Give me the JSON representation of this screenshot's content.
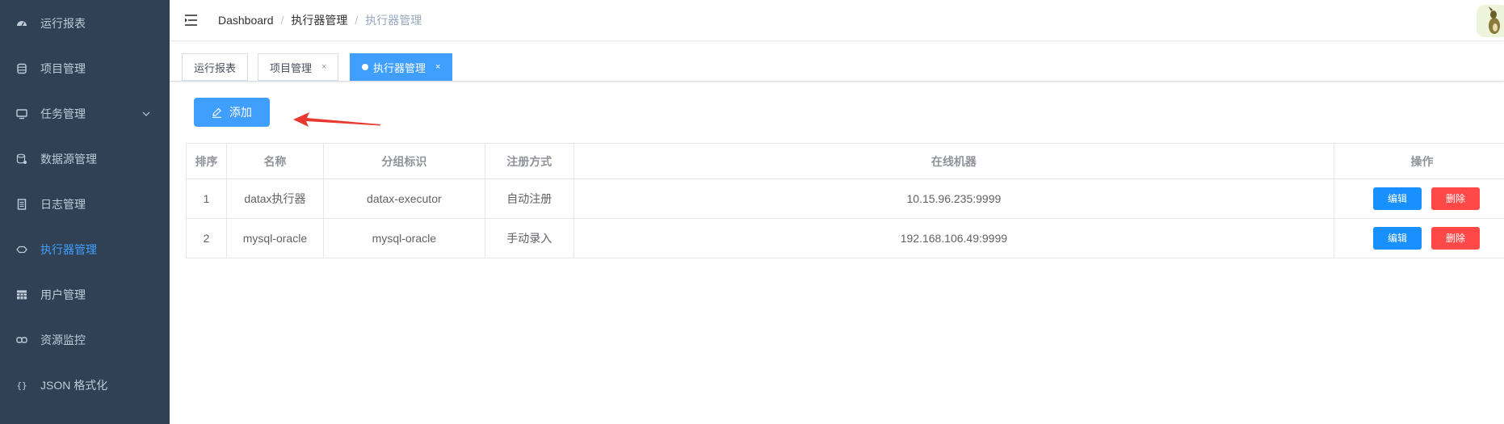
{
  "sidebar": {
    "items": [
      {
        "label": "运行报表",
        "icon": "dashboard-icon"
      },
      {
        "label": "项目管理",
        "icon": "database-icon"
      },
      {
        "label": "任务管理",
        "icon": "monitor-icon"
      },
      {
        "label": "数据源管理",
        "icon": "datasource-icon"
      },
      {
        "label": "日志管理",
        "icon": "document-icon"
      },
      {
        "label": "执行器管理",
        "icon": "executor-icon"
      },
      {
        "label": "用户管理",
        "icon": "table-icon"
      },
      {
        "label": "资源监控",
        "icon": "link-icon"
      },
      {
        "label": "JSON 格式化",
        "icon": "braces-icon"
      }
    ]
  },
  "navbar": {
    "breadcrumb": [
      "Dashboard",
      "执行器管理",
      "执行器管理"
    ]
  },
  "tags": [
    {
      "label": "运行报表"
    },
    {
      "label": "项目管理",
      "close": "×"
    },
    {
      "label": "执行器管理",
      "close": "×"
    }
  ],
  "toolbar": {
    "add_label": "添加"
  },
  "table": {
    "headers": [
      "排序",
      "名称",
      "分组标识",
      "注册方式",
      "在线机器",
      "操作"
    ],
    "rows": [
      {
        "order": "1",
        "name": "datax执行器",
        "group": "datax-executor",
        "reg": "自动注册",
        "machines": "10.15.96.235:9999"
      },
      {
        "order": "2",
        "name": "mysql-oracle",
        "group": "mysql-oracle",
        "reg": "手动录入",
        "machines": "192.168.106.49:9999"
      }
    ],
    "edit_label": "编辑",
    "delete_label": "删除"
  },
  "colors": {
    "sidebar_bg": "#304156",
    "accent": "#409eff",
    "danger": "#ff4949"
  }
}
